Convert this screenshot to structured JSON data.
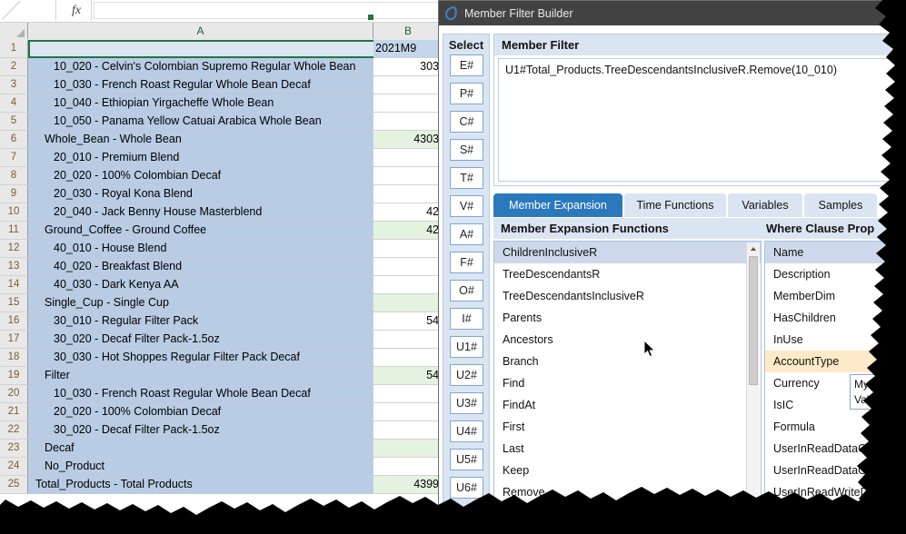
{
  "excel": {
    "formula_bar": {
      "fx_icon": "fx",
      "value": "",
      "name_box": ""
    },
    "columns": [
      "A",
      "B"
    ],
    "rows": [
      {
        "n": "1",
        "a": "",
        "b": "2021M9",
        "indent": 0,
        "b_green": false
      },
      {
        "n": "2",
        "a": "10_020 - Celvin's Colombian Supremo Regular Whole Bean",
        "b": "303",
        "indent": 1,
        "b_green": false
      },
      {
        "n": "3",
        "a": "10_030 - French Roast Regular Whole Bean Decaf",
        "b": "",
        "indent": 1,
        "b_green": false
      },
      {
        "n": "4",
        "a": "10_040 - Ethiopian Yirgacheffe Whole Bean",
        "b": "",
        "indent": 1,
        "b_green": false
      },
      {
        "n": "5",
        "a": "10_050 - Panama Yellow Catuai Arabica Whole Bean",
        "b": "",
        "indent": 1,
        "b_green": false
      },
      {
        "n": "6",
        "a": "Whole_Bean - Whole Bean",
        "b": "4303",
        "indent": 0,
        "b_green": true
      },
      {
        "n": "7",
        "a": "20_010 - Premium Blend",
        "b": "",
        "indent": 1,
        "b_green": false
      },
      {
        "n": "8",
        "a": "20_020 - 100% Colombian Decaf",
        "b": "",
        "indent": 1,
        "b_green": false
      },
      {
        "n": "9",
        "a": "20_030 - Royal Kona Blend",
        "b": "",
        "indent": 1,
        "b_green": false
      },
      {
        "n": "10",
        "a": "20_040 - Jack Benny House Masterblend",
        "b": "42",
        "indent": 1,
        "b_green": false
      },
      {
        "n": "11",
        "a": "Ground_Coffee - Ground Coffee",
        "b": "42",
        "indent": 0,
        "b_green": true
      },
      {
        "n": "12",
        "a": "40_010 - House Blend",
        "b": "",
        "indent": 1,
        "b_green": false
      },
      {
        "n": "13",
        "a": "40_020 - Breakfast Blend",
        "b": "",
        "indent": 1,
        "b_green": false
      },
      {
        "n": "14",
        "a": "40_030 - Dark Kenya AA",
        "b": "",
        "indent": 1,
        "b_green": false
      },
      {
        "n": "15",
        "a": "Single_Cup - Single Cup",
        "b": "",
        "indent": 0,
        "b_green": true
      },
      {
        "n": "16",
        "a": "30_010 - Regular Filter Pack",
        "b": "54",
        "indent": 1,
        "b_green": false
      },
      {
        "n": "17",
        "a": "30_020 - Decaf Filter Pack-1.5oz",
        "b": "",
        "indent": 1,
        "b_green": false
      },
      {
        "n": "18",
        "a": "30_030 - Hot Shoppes Regular Filter Pack Decaf",
        "b": "",
        "indent": 1,
        "b_green": false
      },
      {
        "n": "19",
        "a": "Filter",
        "b": "54",
        "indent": 0,
        "b_green": true
      },
      {
        "n": "20",
        "a": "10_030 - French Roast Regular Whole Bean Decaf",
        "b": "",
        "indent": 1,
        "b_green": false
      },
      {
        "n": "21",
        "a": "20_020 - 100% Colombian Decaf",
        "b": "",
        "indent": 1,
        "b_green": false
      },
      {
        "n": "22",
        "a": "30_020 - Decaf Filter Pack-1.5oz",
        "b": "",
        "indent": 1,
        "b_green": false
      },
      {
        "n": "23",
        "a": "Decaf",
        "b": "",
        "indent": 0,
        "b_green": true
      },
      {
        "n": "24",
        "a": "No_Product",
        "b": "",
        "indent": 0,
        "b_green": false
      },
      {
        "n": "25",
        "a": "Total_Products - Total Products",
        "b": "4399",
        "indent": -1,
        "b_green": true
      }
    ]
  },
  "dialog": {
    "title": "Member Filter Builder",
    "title_icon": "app-loop-icon",
    "select": {
      "label": "Select",
      "buttons": [
        "E#",
        "P#",
        "C#",
        "S#",
        "T#",
        "V#",
        "A#",
        "F#",
        "O#",
        "I#",
        "U1#",
        "U2#",
        "U3#",
        "U4#",
        "U5#",
        "U6#"
      ]
    },
    "member_filter": {
      "header": "Member Filter",
      "value": "U1#Total_Products.TreeDescendantsInclusiveR.Remove(10_010)"
    },
    "tabs": [
      {
        "label": "Member Expansion",
        "active": true
      },
      {
        "label": "Time Functions",
        "active": false
      },
      {
        "label": "Variables",
        "active": false
      },
      {
        "label": "Samples",
        "active": false
      }
    ],
    "left_list": {
      "header": "Member Expansion Functions",
      "items": [
        {
          "label": "ChildrenInclusiveR",
          "state": "selected"
        },
        {
          "label": "TreeDescendantsR",
          "state": "normal"
        },
        {
          "label": "TreeDescendantsInclusiveR",
          "state": "normal"
        },
        {
          "label": "Parents",
          "state": "normal"
        },
        {
          "label": "Ancestors",
          "state": "normal"
        },
        {
          "label": "Branch",
          "state": "normal"
        },
        {
          "label": "Find",
          "state": "normal"
        },
        {
          "label": "FindAt",
          "state": "normal"
        },
        {
          "label": "First",
          "state": "normal"
        },
        {
          "label": "Last",
          "state": "normal"
        },
        {
          "label": "Keep",
          "state": "normal"
        },
        {
          "label": "Remove",
          "state": "normal"
        }
      ]
    },
    "right_list": {
      "header": "Where Clause Prop",
      "items": [
        {
          "label": "Name",
          "state": "selected"
        },
        {
          "label": "Description",
          "state": "normal"
        },
        {
          "label": "MemberDim",
          "state": "normal"
        },
        {
          "label": "HasChildren",
          "state": "normal"
        },
        {
          "label": "InUse",
          "state": "normal"
        },
        {
          "label": "AccountType",
          "state": "highlighted"
        },
        {
          "label": "Currency",
          "state": "normal"
        },
        {
          "label": "IsIC",
          "state": "normal"
        },
        {
          "label": "Formula",
          "state": "normal"
        },
        {
          "label": "UserInReadDataGrou",
          "state": "normal"
        },
        {
          "label": "UserInReadDataGrou",
          "state": "normal"
        },
        {
          "label": "UserInReadWriteD",
          "state": "normal"
        }
      ]
    },
    "tooltip": {
      "line1": "MyMe",
      "line2": "Valid"
    }
  },
  "colors": {
    "accent": "#2b79bd",
    "panel": "#dbe5f1",
    "selection": "#b8cce4",
    "green_cell": "#e4f3e0",
    "highlight": "#fdeac8",
    "titlebar": "#434343"
  }
}
